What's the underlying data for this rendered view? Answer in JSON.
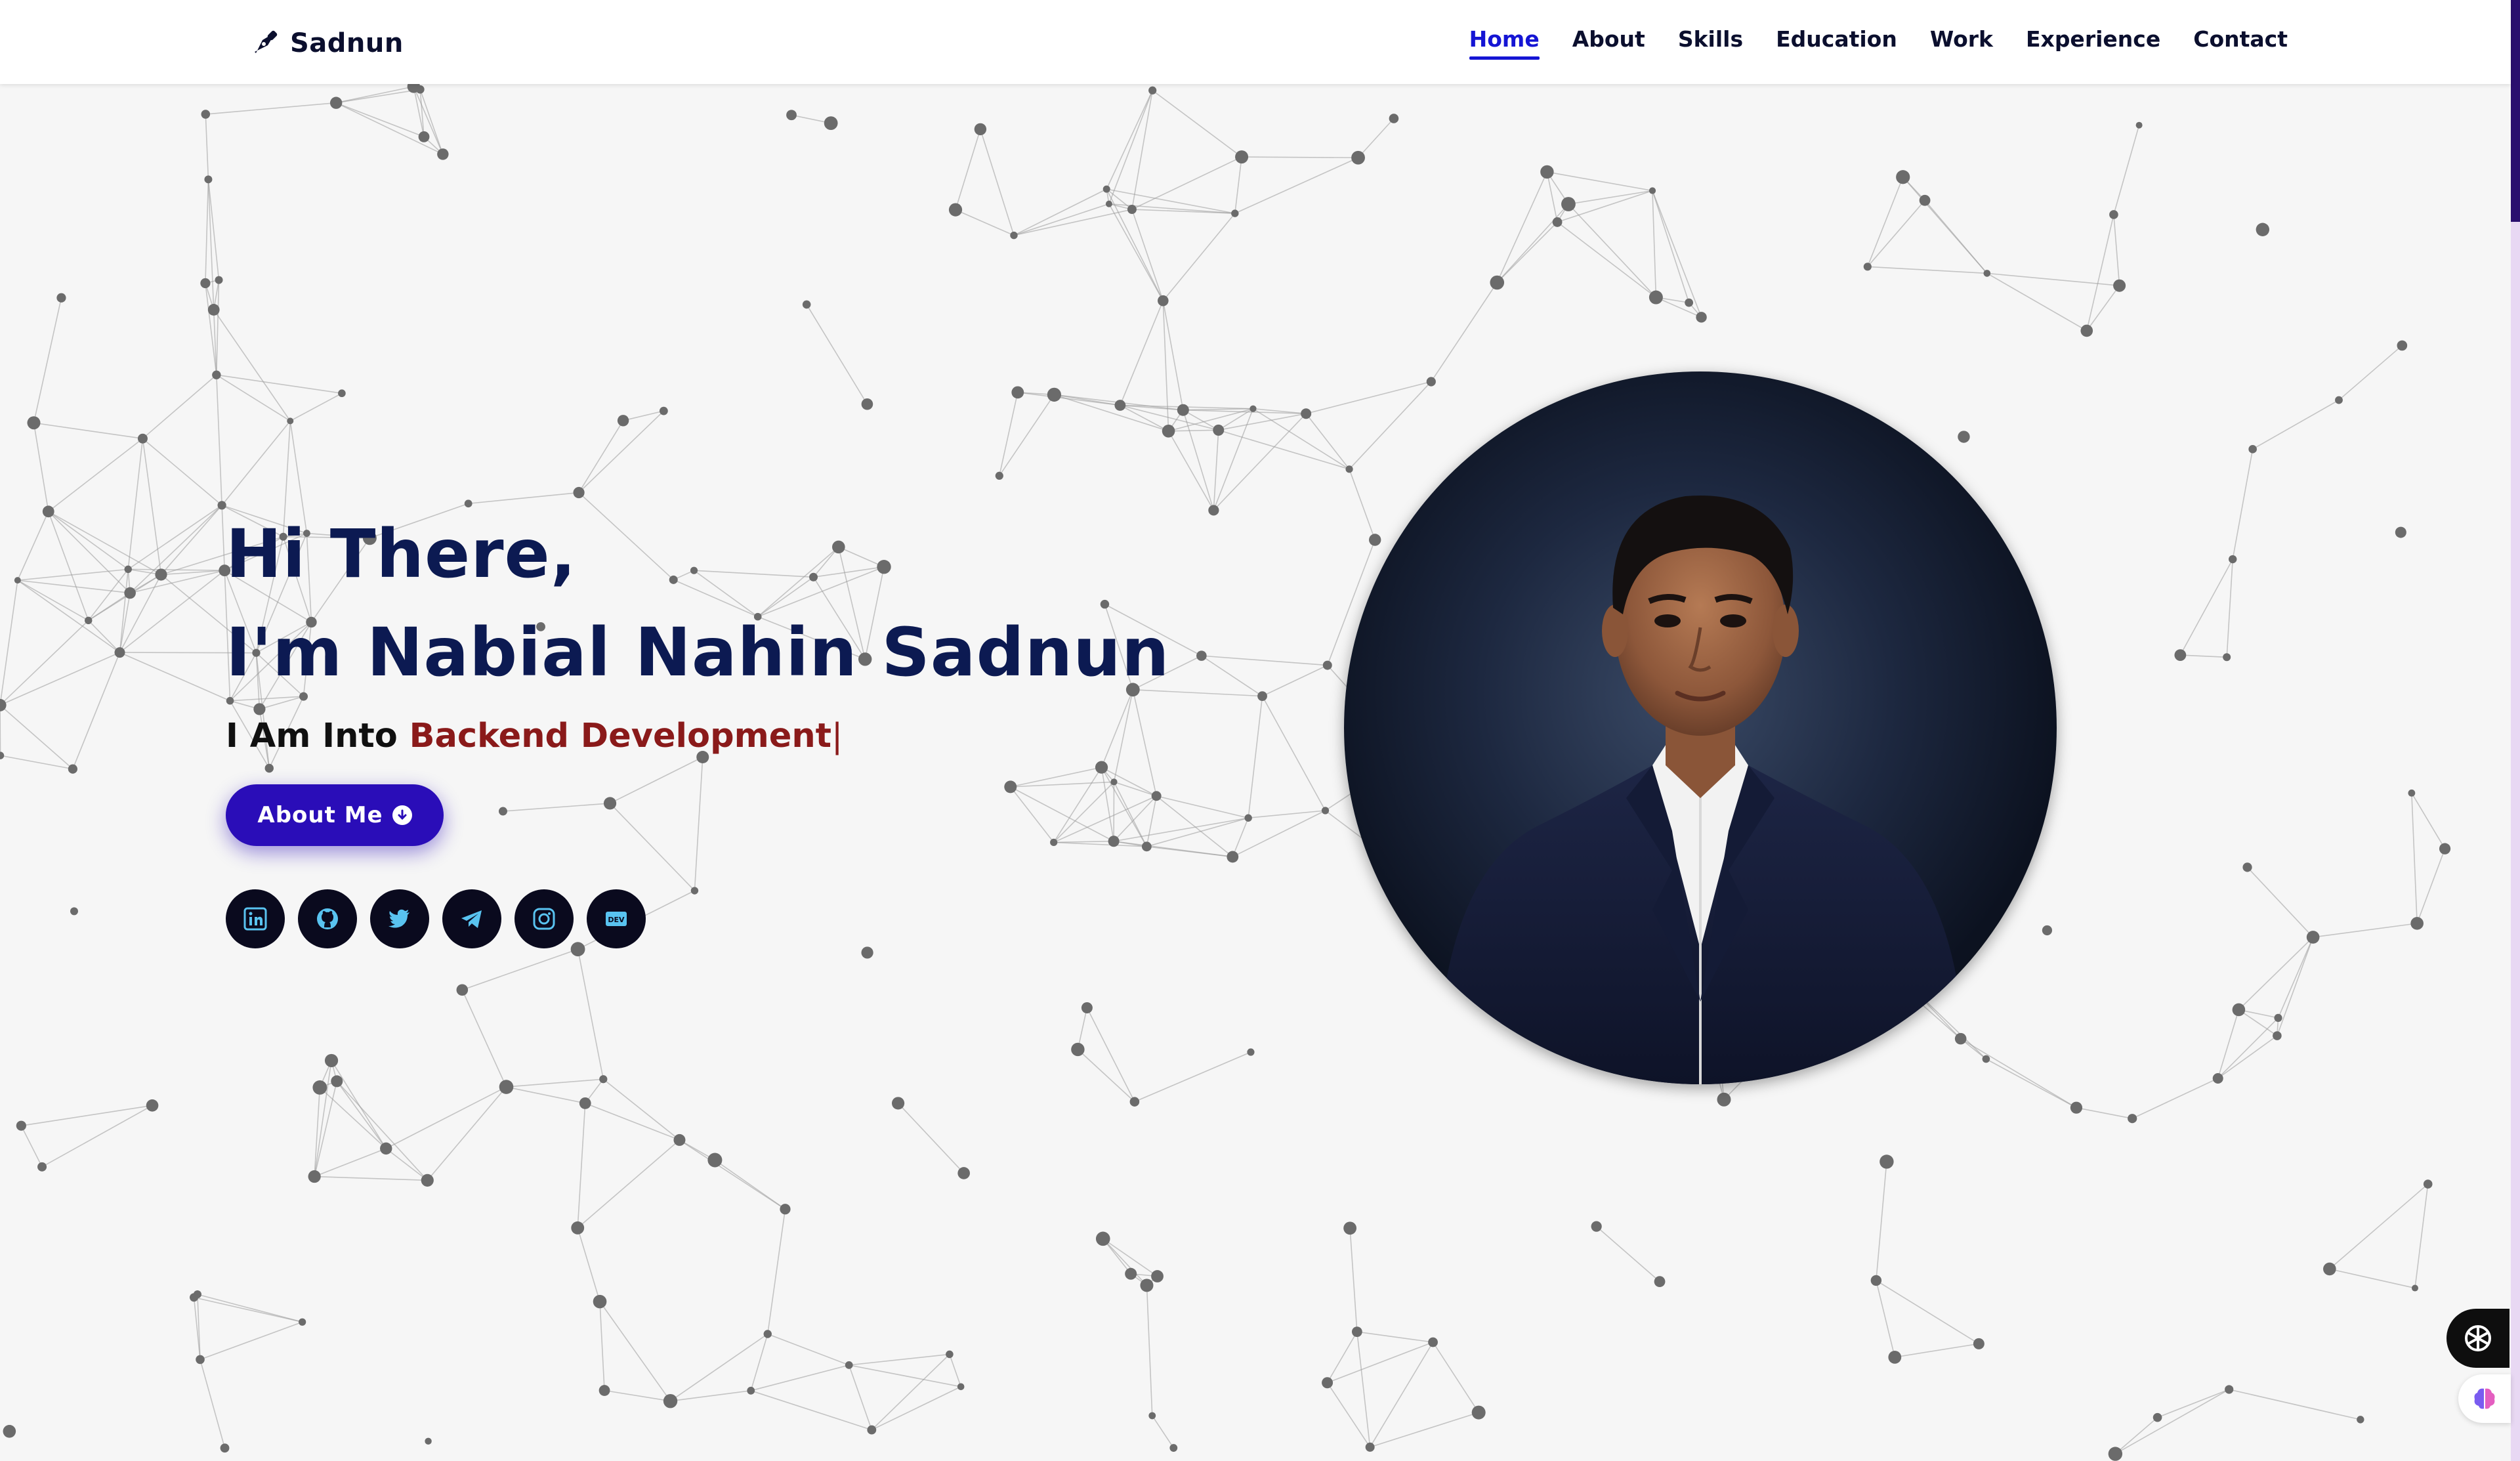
{
  "brand": {
    "name": "Sadnun",
    "icon": "fountain-pen-icon"
  },
  "nav": {
    "items": [
      {
        "label": "Home",
        "active": true
      },
      {
        "label": "About",
        "active": false
      },
      {
        "label": "Skills",
        "active": false
      },
      {
        "label": "Education",
        "active": false
      },
      {
        "label": "Work",
        "active": false
      },
      {
        "label": "Experience",
        "active": false
      },
      {
        "label": "Contact",
        "active": false
      }
    ]
  },
  "hero": {
    "greeting": "Hi There,",
    "intro": "I'm Nabial Nahin Sadnun",
    "typed_prefix": "I Am Into",
    "typed_value": "Backend Development",
    "caret": "|",
    "cta_label": "About Me",
    "cta_icon": "arrow-circle-down-icon"
  },
  "socials": [
    {
      "name": "linkedin-icon"
    },
    {
      "name": "github-icon"
    },
    {
      "name": "twitter-icon"
    },
    {
      "name": "telegram-icon"
    },
    {
      "name": "instagram-icon"
    },
    {
      "name": "dev-icon",
      "text": "DEV"
    }
  ],
  "colors": {
    "heading": "#0c1a52",
    "accent_text": "#8a1a1a",
    "nav_active": "#1515d4",
    "cta_bg": "#2a0db8",
    "social_bg": "#0a0a1e",
    "social_icon": "#59c3f0"
  },
  "widgets": {
    "chat": "openai-icon",
    "brain": "brain-icon"
  }
}
